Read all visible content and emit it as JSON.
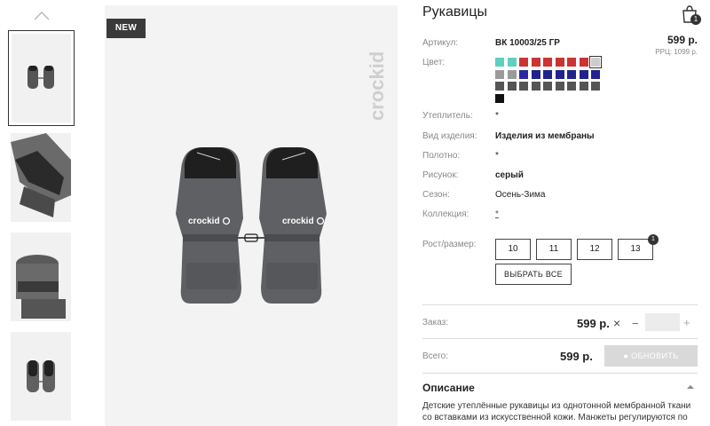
{
  "product": {
    "title": "Рукавицы",
    "new_badge": "NEW",
    "brand": "crockid"
  },
  "cart": {
    "count": "1"
  },
  "details": {
    "article_label": "Артикул:",
    "article_value": "ВК 10003/25 ГР",
    "color_label": "Цвет:",
    "insulation_label": "Утеплитель:",
    "insulation_value": "*",
    "kind_label": "Вид изделия:",
    "kind_value": "Изделия из мембраны",
    "fabric_label": "Полотно:",
    "fabric_value": "*",
    "pattern_label": "Рисунок:",
    "pattern_value": "серый",
    "season_label": "Сезон:",
    "season_value": "Осень-Зима",
    "collection_label": "Коллекция:",
    "collection_value": "*"
  },
  "price": {
    "value": "599 р.",
    "rrp": "РРЦ: 1099 р."
  },
  "swatch_colors": [
    "#5ecfc0",
    "#5ecfc0",
    "#cc3333",
    "#cc3333",
    "#cc3333",
    "#cc3333",
    "#cc3333",
    "#cc3333",
    "#cccccc",
    "#9a9a9a",
    "#9a9a9a",
    "#2a2aa0",
    "#22228c",
    "#22228c",
    "#22228c",
    "#22228c",
    "#22228c",
    "#22228c",
    "#555555",
    "#555555",
    "#555555",
    "#555555",
    "#555555",
    "#555555",
    "#555555",
    "#555555",
    "#555555",
    "#111111"
  ],
  "sizes": {
    "label": "Рост/размер:",
    "options": [
      "10",
      "11",
      "12",
      "13"
    ],
    "selected_count": "1",
    "select_all": "ВЫБРАТЬ ВСЕ"
  },
  "order": {
    "label": "Заказ:",
    "price": "599 р.",
    "remove": "×",
    "minus": "−",
    "plus": "+"
  },
  "total": {
    "label": "Всего:",
    "price": "599 р.",
    "update_label": "ОБНОВИТЬ"
  },
  "description": {
    "title": "Описание",
    "text": "Детские утеплённые рукавицы из однотонной мембранной ткани со вставками из искусственной кожи. Манжеты регулируются по"
  },
  "colors": {
    "accent_dark": "#333333",
    "button_disabled": "#d9d9d9"
  }
}
